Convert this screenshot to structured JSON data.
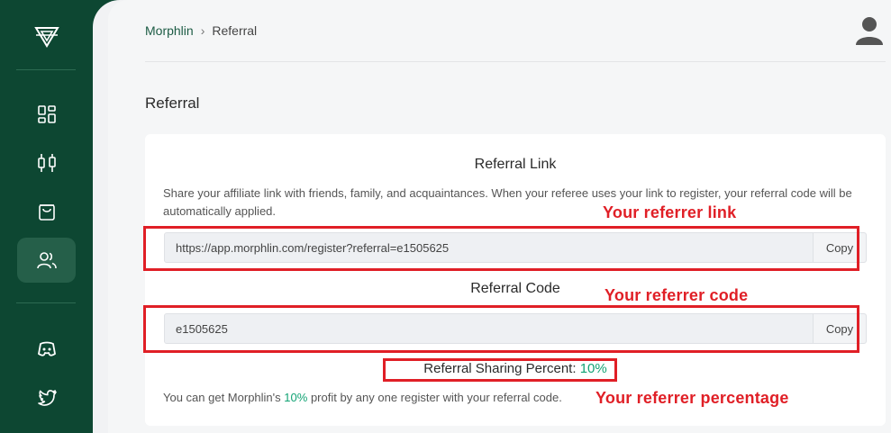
{
  "colors": {
    "sidebar": "#0d4732",
    "accent": "#12a374",
    "annotation": "#e01f26"
  },
  "sidebar": {
    "logo_icon": "morphlin-logo-icon",
    "items": [
      {
        "icon": "dashboard-icon",
        "active": false
      },
      {
        "icon": "candlestick-icon",
        "active": false
      },
      {
        "icon": "shopping-bag-icon",
        "active": false
      },
      {
        "icon": "users-icon",
        "active": true
      },
      {
        "icon": "discord-icon",
        "active": false
      },
      {
        "icon": "twitter-icon",
        "active": false
      }
    ]
  },
  "breadcrumb": {
    "root": "Morphlin",
    "separator": "›",
    "current": "Referral"
  },
  "header": {
    "avatar_icon": "user-avatar-icon"
  },
  "page": {
    "title": "Referral"
  },
  "referral": {
    "link_title": "Referral Link",
    "description": "Share your affiliate link with friends, family, and acquaintances. When your referee uses your link to register, your referral code will be automatically applied.",
    "link_value": "https://app.morphlin.com/register?referral=e1505625",
    "copy_label": "Copy",
    "code_title": "Referral Code",
    "code_value": "e1505625",
    "percent_label": "Referral Sharing Percent:",
    "percent_value": "10%",
    "footer_pre": "You can get Morphlin's",
    "footer_percent": "10%",
    "footer_post": "profit by any one register with your referral code."
  },
  "annotations": {
    "link": "Your referrer link",
    "code": "Your referrer code",
    "percent": "Your referrer percentage"
  }
}
